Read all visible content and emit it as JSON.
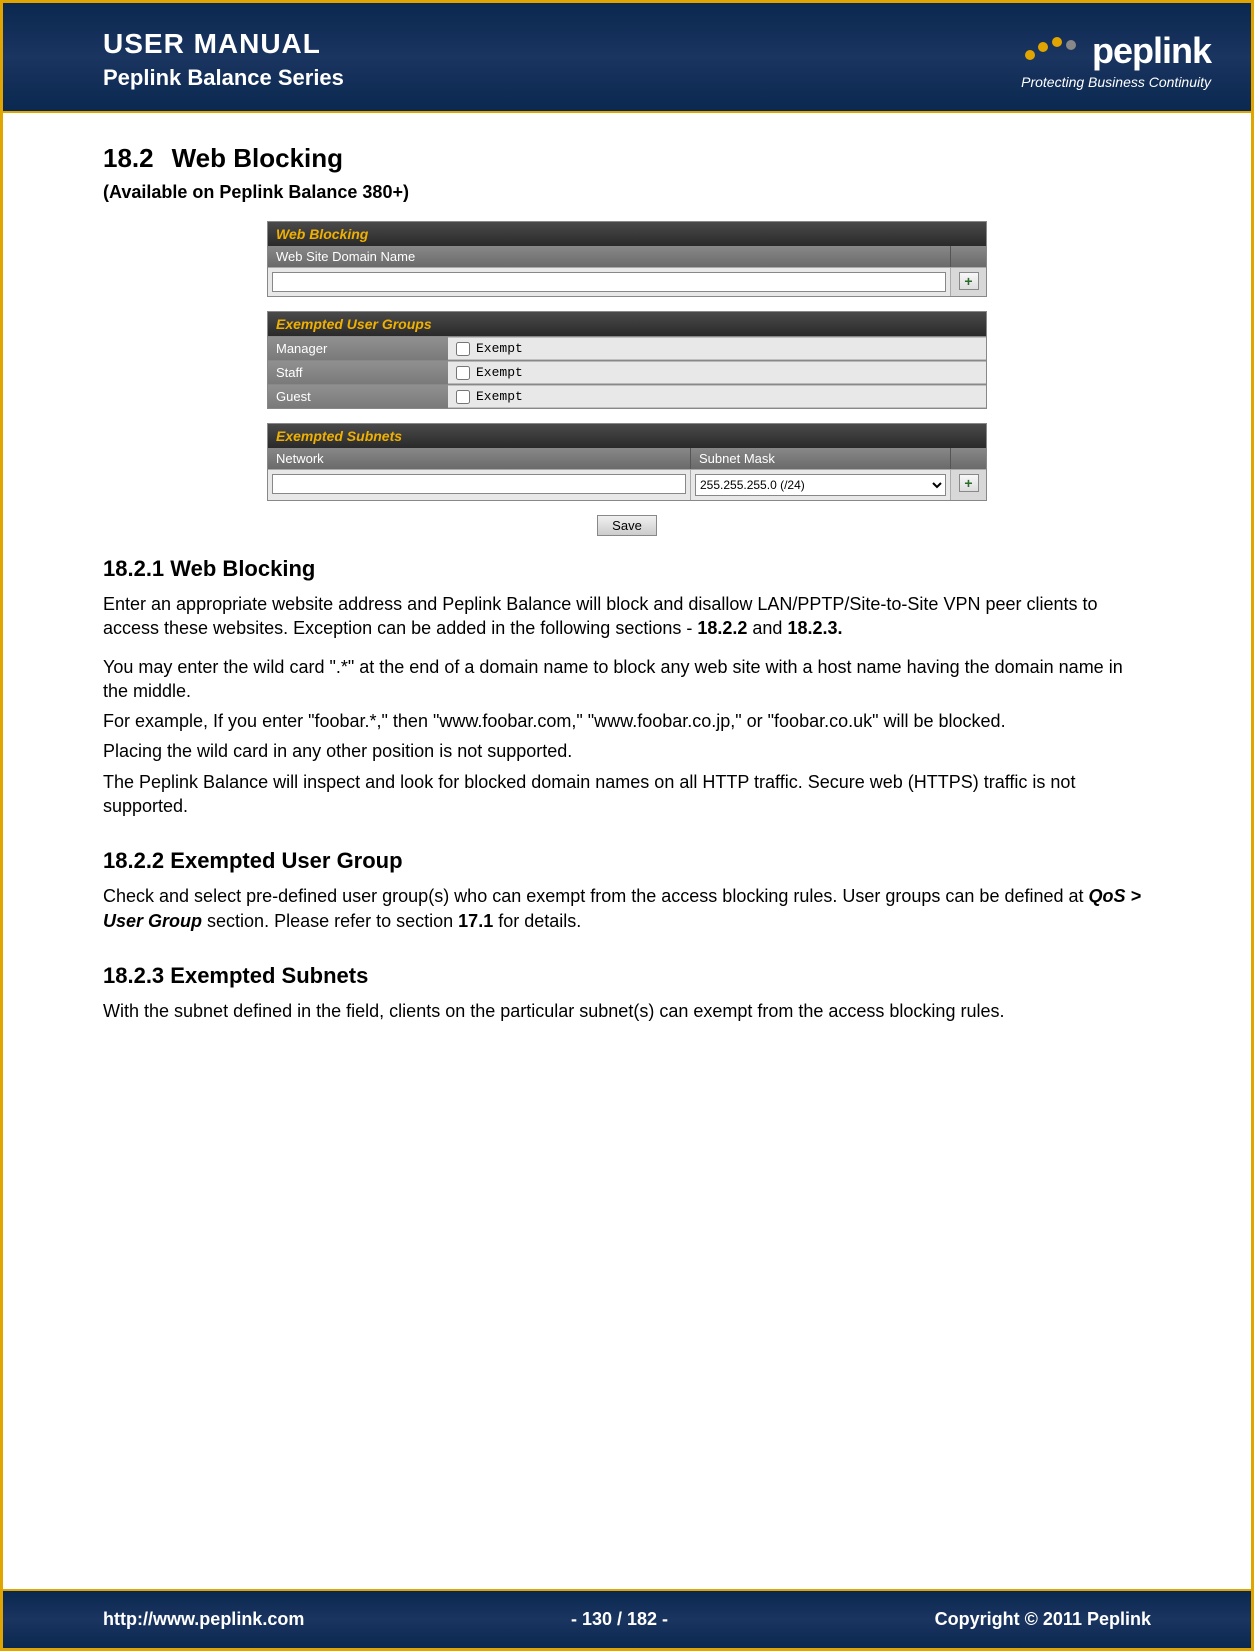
{
  "header": {
    "title": "USER MANUAL",
    "subtitle": "Peplink Balance Series",
    "brand": "peplink",
    "tagline": "Protecting Business Continuity"
  },
  "section": {
    "number": "18.2",
    "title": "Web Blocking",
    "availability": "(Available on Peplink Balance 380+)"
  },
  "panels": {
    "web_blocking": {
      "title": "Web Blocking",
      "col1": "Web Site Domain Name",
      "domain_value": "",
      "add_icon": "+"
    },
    "exempted_groups": {
      "title": "Exempted User Groups",
      "rows": [
        {
          "name": "Manager",
          "label": "Exempt",
          "checked": false
        },
        {
          "name": "Staff",
          "label": "Exempt",
          "checked": false
        },
        {
          "name": "Guest",
          "label": "Exempt",
          "checked": false
        }
      ]
    },
    "exempted_subnets": {
      "title": "Exempted Subnets",
      "col1": "Network",
      "col2": "Subnet Mask",
      "network_value": "",
      "mask_value": "255.255.255.0 (/24)",
      "add_icon": "+"
    },
    "save_label": "Save"
  },
  "body": {
    "h1": "18.2.1 Web Blocking",
    "p1a": "Enter an appropriate website address and Peplink Balance will block and disallow LAN/PPTP/Site-to-Site VPN peer clients to access these websites. Exception can be added in the following sections - ",
    "p1b": "18.2.2",
    "p1c": " and ",
    "p1d": "18.2.3.",
    "p2": "You may enter the wild card \".*\" at the end of a domain name to block any web site with a host name having the domain name in the middle.",
    "p3": "For example, If you enter \"foobar.*,\" then \"www.foobar.com,\" \"www.foobar.co.jp,\" or \"foobar.co.uk\" will be blocked.",
    "p4": "Placing the wild card in any other position is not supported.",
    "p5": "The Peplink Balance will inspect and look for blocked domain names on all HTTP traffic.  Secure web (HTTPS) traffic is not supported.",
    "h2": "18.2.2 Exempted User Group",
    "p6a": "Check and select pre-defined user group(s) who can exempt from the access blocking rules. User groups can be defined at ",
    "p6b": "QoS > User Group",
    "p6c": " section. Please refer to section ",
    "p6d": "17.1",
    "p6e": " for details.",
    "h3": "18.2.3 Exempted Subnets",
    "p7": "With the subnet defined in the field, clients on the particular subnet(s) can exempt from the access blocking rules."
  },
  "footer": {
    "url": "http://www.peplink.com",
    "page": "- 130 / 182 -",
    "copyright": "Copyright © 2011 Peplink"
  }
}
